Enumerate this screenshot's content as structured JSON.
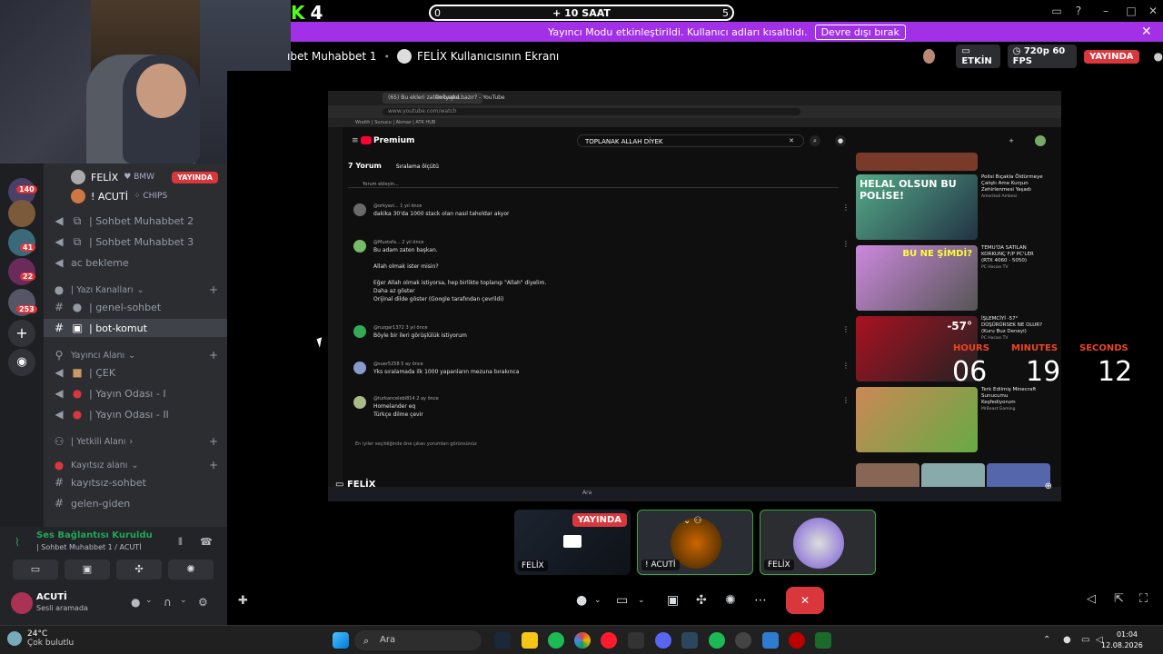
{
  "kick": {
    "logo": "K",
    "number": "4"
  },
  "timer_bar": {
    "left": "0",
    "center": "+ 10 SAAT",
    "right": "5"
  },
  "banner": {
    "text": "Yayıncı Modu etkinleştirildi. Kullanıcı adları kısaltıldı.",
    "button": "Devre dışı bırak"
  },
  "header": {
    "channel": "ıbet Muhabbet 1",
    "screen_title": "FELİX Kullanıcısının Ekranı",
    "active_label": "ETKİN",
    "quality": "720p 60 FPS",
    "live": "YAYINDA"
  },
  "voice_users": [
    {
      "name": "FELİX",
      "tag": "BMW",
      "live": "YAYINDA"
    },
    {
      "name": "! ACUTİ",
      "tag": "CHIPS"
    }
  ],
  "channels": [
    {
      "icon": "speaker-icon",
      "label": "| Sohbet Muhabbet 2"
    },
    {
      "icon": "speaker-icon",
      "label": "| Sohbet Muhabbet 3"
    },
    {
      "icon": "speaker-icon",
      "label": "ac bekleme"
    }
  ],
  "categories": {
    "text": "| Yazı Kanalları",
    "streamer": "Yayıncı Alanı",
    "staff": "| Yetkili Alanı",
    "unregistered": "Kayıtsız alanı"
  },
  "text_channels": [
    "| genel-sohbet",
    "| bot-komut"
  ],
  "streamer_channels": [
    "| ÇEK",
    "| Yayın Odası - I",
    "| Yayın Odası - II"
  ],
  "unreg_channels": [
    "kayıtsız-sohbet",
    "gelen-giden"
  ],
  "guild_badges": [
    "140",
    "41",
    "22",
    "253"
  ],
  "voice_panel": {
    "status": "Ses Bağlantısı Kuruldu",
    "sub": "| Sohbet Muhabbet 1 / ACUTİ"
  },
  "user_panel": {
    "name": "ACUTİ",
    "status": "Sesli aramada"
  },
  "shared_screen": {
    "tabs": [
      "(65) Bu ekleri zaten başka...",
      "Dokyand hazır? - YouTube"
    ],
    "url": "www.youtube.com/watch",
    "bookmarks": "Wraith | Sunucu | Akmaz | ATK HUB",
    "yt_logo": "Premium",
    "search": "TOPLANAK ALLAH DİYEK",
    "comment_count": "7 Yorum",
    "sort": "Sıralama ölçütü",
    "add_comment": "Yorum ekleyin...",
    "comments": [
      {
        "user": "@orkyazi...  1 yıl önce",
        "text": "dakika 30'da 1000 stack olan nasıl taholdar akyor"
      },
      {
        "user": "@Mustafa...  2 yıl önce",
        "text": "Bu adam zaten başkan.\n\nAllah olmak ister misin?\n\nEğer Allah olmak istiyorsa, hep birlikte toplanıp \"Allah\" diyelim.\nDaha az göster\nOrijinal dilde göster (Google tarafından çevrildi)"
      },
      {
        "user": "@ruzgar1372  3 yıl önce",
        "text": "Böyle bir ileri görüşlülük istiyorum"
      },
      {
        "user": "@suer5258  5 ay önce",
        "text": "Yks sıralamada ilk 1000 yapanların mezuna bırakınca"
      },
      {
        "user": "@turkancelebi814  2 ay önce",
        "text": "Homelander eq\nTürkçe dilme çevir"
      }
    ],
    "footer": "En iyiler seçildiğinde öne çıkan yorumları görünsünüz",
    "videos": [
      {
        "title": "Polisi Bıçakla Öldürmeye Çalıştı Ama Kurşun Zehirlenmesi Yaşadı",
        "meta": "Amerikali Ambesi",
        "thumb_text": "HELAL OLSUN BU POLİSE!"
      },
      {
        "title": "TEMU'DA SATILAN KORKUNÇ F/P PC'LER (RTX 4060 - 5050)",
        "meta": "PC Hocası TV",
        "thumb_text": "BU NE ŞİMDİ?"
      },
      {
        "title": "İŞLEMCİYİ -57° DÜŞÜRÜRSEK NE OLUR? (Kuru Buz Deneyi)",
        "meta": "PC Hocası TV",
        "thumb_text": "-57°"
      },
      {
        "title": "Terk Edilmiş Minecraft Sunucumu Keşfediyorum",
        "meta": "MrBeast Gaming",
        "thumb_text": ""
      }
    ],
    "sharer": "FELİX",
    "win_search": "Ara"
  },
  "countdown": {
    "h_label": "HOURS",
    "m_label": "MINUTES",
    "s_label": "SECONDS",
    "h": "06",
    "m": "19",
    "s": "12"
  },
  "tiles": [
    {
      "label": "FELİX",
      "badge": "YAYINDA"
    },
    {
      "label": "! ACUTİ"
    },
    {
      "label": "FELİX"
    }
  ],
  "taskbar": {
    "temp": "24°C",
    "weather": "Çok bulutlu",
    "search": "Ara",
    "time": "01:04",
    "date": "12.08.2026"
  },
  "colors": {
    "discord_bg": "#2b2d31",
    "live_red": "#da373c",
    "banner_purple": "#a130e6",
    "kick_green": "#53fc18"
  }
}
